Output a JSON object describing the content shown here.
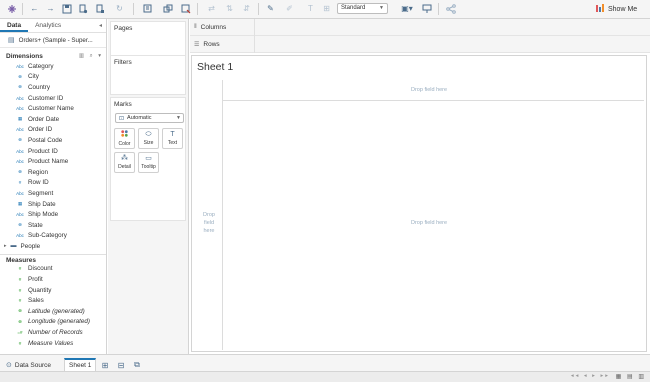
{
  "toolbar": {
    "fit_value": "Standard",
    "show_me_label": "Show Me",
    "icons": [
      "tableau-logo-icon",
      "back-icon",
      "forward-icon",
      "save-icon",
      "new-datasource-icon",
      "pause-updates-icon",
      "run-update-icon",
      "new-worksheet-icon",
      "duplicate-icon",
      "clear-icon",
      "swap-icon",
      "sort-asc-icon",
      "sort-desc-icon",
      "highlight-icon",
      "group-icon",
      "labels-icon",
      "fix-axes-icon",
      "fit-icon",
      "presentation-icon",
      "share-icon"
    ]
  },
  "data_pane": {
    "tab_data": "Data",
    "tab_analytics": "Analytics",
    "datasource": "Orders+ (Sample - Super...",
    "dimensions_label": "Dimensions",
    "dimensions": [
      {
        "type": "Abc",
        "name": "Category"
      },
      {
        "type": "geo",
        "name": "City"
      },
      {
        "type": "geo",
        "name": "Country"
      },
      {
        "type": "Abc",
        "name": "Customer ID"
      },
      {
        "type": "Abc",
        "name": "Customer Name"
      },
      {
        "type": "date",
        "name": "Order Date"
      },
      {
        "type": "Abc",
        "name": "Order ID"
      },
      {
        "type": "geo",
        "name": "Postal Code"
      },
      {
        "type": "Abc",
        "name": "Product ID"
      },
      {
        "type": "Abc",
        "name": "Product Name"
      },
      {
        "type": "geo",
        "name": "Region"
      },
      {
        "type": "#",
        "name": "Row ID"
      },
      {
        "type": "Abc",
        "name": "Segment"
      },
      {
        "type": "date",
        "name": "Ship Date"
      },
      {
        "type": "Abc",
        "name": "Ship Mode"
      },
      {
        "type": "geo",
        "name": "State"
      },
      {
        "type": "Abc",
        "name": "Sub-Category"
      }
    ],
    "folder": "People",
    "measures_label": "Measures",
    "measures": [
      {
        "type": "#",
        "name": "Discount",
        "italic": false
      },
      {
        "type": "#",
        "name": "Profit",
        "italic": false
      },
      {
        "type": "#",
        "name": "Quantity",
        "italic": false
      },
      {
        "type": "#",
        "name": "Sales",
        "italic": false
      },
      {
        "type": "geo",
        "name": "Latitude (generated)",
        "italic": true
      },
      {
        "type": "geo",
        "name": "Longitude (generated)",
        "italic": true
      },
      {
        "type": "=#",
        "name": "Number of Records",
        "italic": true
      },
      {
        "type": "#",
        "name": "Measure Values",
        "italic": true
      }
    ]
  },
  "cards": {
    "pages": "Pages",
    "filters": "Filters",
    "marks": "Marks",
    "marks_type": "Automatic",
    "buttons": {
      "color": "Color",
      "size": "Size",
      "text": "Text",
      "detail": "Detail",
      "tooltip": "Tooltip"
    }
  },
  "shelves": {
    "columns": "Columns",
    "rows": "Rows"
  },
  "view": {
    "sheet_title": "Sheet 1",
    "drop_top": "Drop field here",
    "drop_left": "Drop field here",
    "drop_center": "Drop field here"
  },
  "tabs": {
    "data_source": "Data Source",
    "sheet1": "Sheet 1"
  },
  "colors": {
    "accent": "#1f77b4",
    "dimension": "#1f77b4",
    "measure": "#2ca02c",
    "placeholder": "#9aaec0"
  }
}
